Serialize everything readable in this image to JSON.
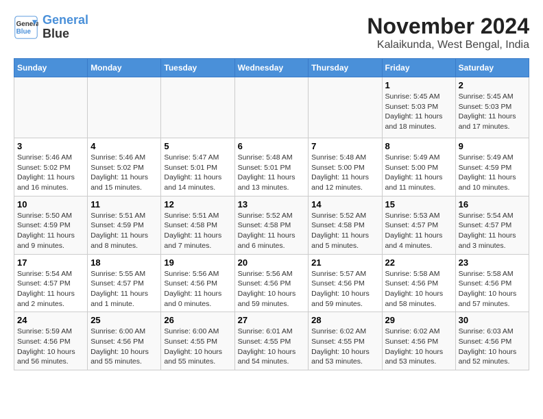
{
  "logo": {
    "line1": "General",
    "line2": "Blue"
  },
  "title": "November 2024",
  "subtitle": "Kalaikunda, West Bengal, India",
  "headers": [
    "Sunday",
    "Monday",
    "Tuesday",
    "Wednesday",
    "Thursday",
    "Friday",
    "Saturday"
  ],
  "weeks": [
    [
      {
        "day": "",
        "detail": ""
      },
      {
        "day": "",
        "detail": ""
      },
      {
        "day": "",
        "detail": ""
      },
      {
        "day": "",
        "detail": ""
      },
      {
        "day": "",
        "detail": ""
      },
      {
        "day": "1",
        "detail": "Sunrise: 5:45 AM\nSunset: 5:03 PM\nDaylight: 11 hours and 18 minutes."
      },
      {
        "day": "2",
        "detail": "Sunrise: 5:45 AM\nSunset: 5:03 PM\nDaylight: 11 hours and 17 minutes."
      }
    ],
    [
      {
        "day": "3",
        "detail": "Sunrise: 5:46 AM\nSunset: 5:02 PM\nDaylight: 11 hours and 16 minutes."
      },
      {
        "day": "4",
        "detail": "Sunrise: 5:46 AM\nSunset: 5:02 PM\nDaylight: 11 hours and 15 minutes."
      },
      {
        "day": "5",
        "detail": "Sunrise: 5:47 AM\nSunset: 5:01 PM\nDaylight: 11 hours and 14 minutes."
      },
      {
        "day": "6",
        "detail": "Sunrise: 5:48 AM\nSunset: 5:01 PM\nDaylight: 11 hours and 13 minutes."
      },
      {
        "day": "7",
        "detail": "Sunrise: 5:48 AM\nSunset: 5:00 PM\nDaylight: 11 hours and 12 minutes."
      },
      {
        "day": "8",
        "detail": "Sunrise: 5:49 AM\nSunset: 5:00 PM\nDaylight: 11 hours and 11 minutes."
      },
      {
        "day": "9",
        "detail": "Sunrise: 5:49 AM\nSunset: 4:59 PM\nDaylight: 11 hours and 10 minutes."
      }
    ],
    [
      {
        "day": "10",
        "detail": "Sunrise: 5:50 AM\nSunset: 4:59 PM\nDaylight: 11 hours and 9 minutes."
      },
      {
        "day": "11",
        "detail": "Sunrise: 5:51 AM\nSunset: 4:59 PM\nDaylight: 11 hours and 8 minutes."
      },
      {
        "day": "12",
        "detail": "Sunrise: 5:51 AM\nSunset: 4:58 PM\nDaylight: 11 hours and 7 minutes."
      },
      {
        "day": "13",
        "detail": "Sunrise: 5:52 AM\nSunset: 4:58 PM\nDaylight: 11 hours and 6 minutes."
      },
      {
        "day": "14",
        "detail": "Sunrise: 5:52 AM\nSunset: 4:58 PM\nDaylight: 11 hours and 5 minutes."
      },
      {
        "day": "15",
        "detail": "Sunrise: 5:53 AM\nSunset: 4:57 PM\nDaylight: 11 hours and 4 minutes."
      },
      {
        "day": "16",
        "detail": "Sunrise: 5:54 AM\nSunset: 4:57 PM\nDaylight: 11 hours and 3 minutes."
      }
    ],
    [
      {
        "day": "17",
        "detail": "Sunrise: 5:54 AM\nSunset: 4:57 PM\nDaylight: 11 hours and 2 minutes."
      },
      {
        "day": "18",
        "detail": "Sunrise: 5:55 AM\nSunset: 4:57 PM\nDaylight: 11 hours and 1 minute."
      },
      {
        "day": "19",
        "detail": "Sunrise: 5:56 AM\nSunset: 4:56 PM\nDaylight: 11 hours and 0 minutes."
      },
      {
        "day": "20",
        "detail": "Sunrise: 5:56 AM\nSunset: 4:56 PM\nDaylight: 10 hours and 59 minutes."
      },
      {
        "day": "21",
        "detail": "Sunrise: 5:57 AM\nSunset: 4:56 PM\nDaylight: 10 hours and 59 minutes."
      },
      {
        "day": "22",
        "detail": "Sunrise: 5:58 AM\nSunset: 4:56 PM\nDaylight: 10 hours and 58 minutes."
      },
      {
        "day": "23",
        "detail": "Sunrise: 5:58 AM\nSunset: 4:56 PM\nDaylight: 10 hours and 57 minutes."
      }
    ],
    [
      {
        "day": "24",
        "detail": "Sunrise: 5:59 AM\nSunset: 4:56 PM\nDaylight: 10 hours and 56 minutes."
      },
      {
        "day": "25",
        "detail": "Sunrise: 6:00 AM\nSunset: 4:56 PM\nDaylight: 10 hours and 55 minutes."
      },
      {
        "day": "26",
        "detail": "Sunrise: 6:00 AM\nSunset: 4:55 PM\nDaylight: 10 hours and 55 minutes."
      },
      {
        "day": "27",
        "detail": "Sunrise: 6:01 AM\nSunset: 4:55 PM\nDaylight: 10 hours and 54 minutes."
      },
      {
        "day": "28",
        "detail": "Sunrise: 6:02 AM\nSunset: 4:55 PM\nDaylight: 10 hours and 53 minutes."
      },
      {
        "day": "29",
        "detail": "Sunrise: 6:02 AM\nSunset: 4:56 PM\nDaylight: 10 hours and 53 minutes."
      },
      {
        "day": "30",
        "detail": "Sunrise: 6:03 AM\nSunset: 4:56 PM\nDaylight: 10 hours and 52 minutes."
      }
    ]
  ]
}
